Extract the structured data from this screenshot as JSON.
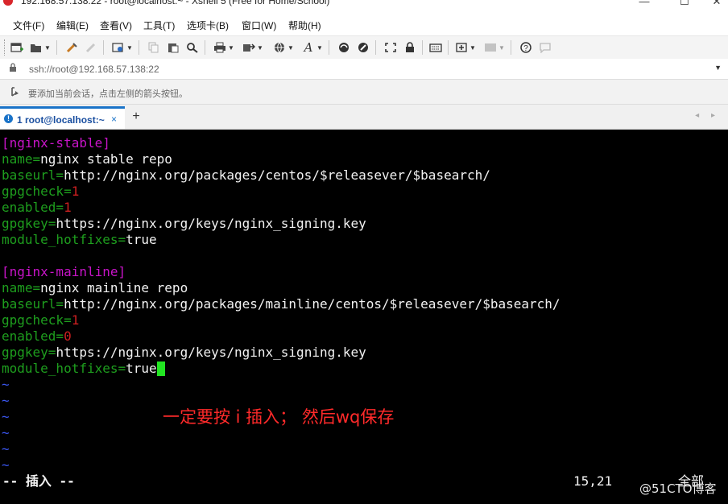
{
  "window": {
    "title": "192.168.57.138:22 - root@localhost:~ - Xshell 5 (Free for Home/School)",
    "minimize_glyph": "—",
    "maximize_glyph": "☐",
    "close_glyph": "✕"
  },
  "menu": [
    "文件(F)",
    "编辑(E)",
    "查看(V)",
    "工具(T)",
    "选项卡(B)",
    "窗口(W)",
    "帮助(H)"
  ],
  "toolbar": {
    "icons": [
      "new-session-icon",
      "open-folder-icon",
      "dropdown-icon",
      "connect-icon",
      "disconnect-icon",
      "properties-icon",
      "copy-icon",
      "paste-icon",
      "find-icon",
      "print-icon",
      "transfer-icon",
      "globe-icon",
      "font-icon",
      "xftp-icon",
      "xmanager-icon",
      "fullscreen-icon",
      "lock-icon",
      "keyboard-icon",
      "add-tab-icon",
      "layout-icon",
      "help-icon",
      "chat-icon"
    ]
  },
  "address": {
    "value": "ssh://root@192.168.57.138:22",
    "lock_glyph": "🔒",
    "dropdown_glyph": "▼"
  },
  "hint": {
    "text": "要添加当前会话，点击左侧的箭头按钮。",
    "icon_glyph": "↪"
  },
  "tabs": [
    {
      "number": "1",
      "label": "1 root@localhost:~",
      "close_glyph": "×",
      "status_glyph": "!"
    }
  ],
  "add_tab_glyph": "+",
  "tab_nav": "◂ ▸",
  "terminal": {
    "lines": [
      {
        "key": "[nginx-stable]",
        "value": ""
      },
      {
        "key": "name=",
        "value": "nginx stable repo"
      },
      {
        "key": "baseurl=",
        "value": "http://nginx.org/packages/centos/$releasever/$basearch/"
      },
      {
        "key": "gpgcheck=",
        "value": "1"
      },
      {
        "key": "enabled=",
        "value": "1"
      },
      {
        "key": "gpgkey=",
        "value": "https://nginx.org/keys/nginx_signing.key"
      },
      {
        "key": "module_hotfixes=",
        "value": "true"
      },
      {
        "key": "",
        "value": ""
      },
      {
        "key": "[nginx-mainline]",
        "value": ""
      },
      {
        "key": "name=",
        "value": "nginx mainline repo"
      },
      {
        "key": "baseurl=",
        "value": "http://nginx.org/packages/mainline/centos/$releasever/$basearch/"
      },
      {
        "key": "gpgcheck=",
        "value": "1"
      },
      {
        "key": "enabled=",
        "value": "0"
      },
      {
        "key": "gpgkey=",
        "value": "https://nginx.org/keys/nginx_signing.key"
      },
      {
        "key": "module_hotfixes=",
        "value": "true"
      }
    ],
    "tildes": [
      "~",
      "~",
      "~",
      "~",
      "~",
      "~"
    ],
    "annotation": "一定要按 i 插入； 然后wq保存",
    "mode": "-- 插入 --",
    "cursor_pos": "15,21",
    "scroll_state": "全部",
    "watermark": "@51CTO博客"
  },
  "colors": {
    "section": "#c814c8",
    "key": "#1e9e1e",
    "number": "#cc2020",
    "text": "#f2f2f2",
    "tilde": "#3a56f0",
    "cursor": "#22e522",
    "annotation": "#ff2a2a",
    "tab_accent": "#1a73c8"
  }
}
